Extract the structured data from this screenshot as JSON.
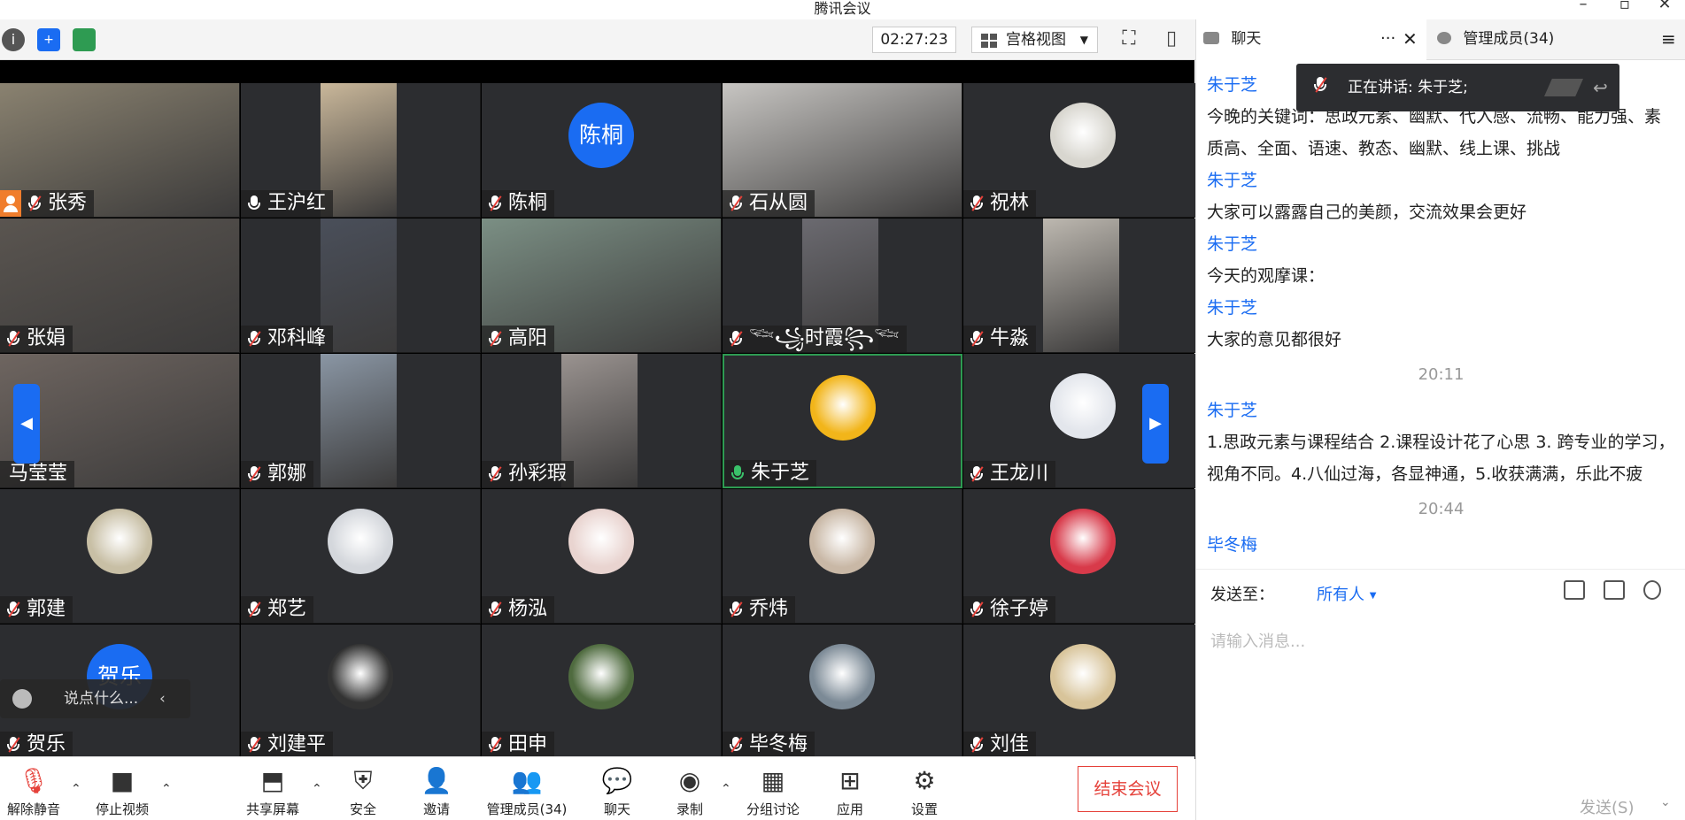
{
  "window": {
    "title": "腾讯会议"
  },
  "toolbar": {
    "timer": "02:27:23",
    "view_mode": "宫格视图"
  },
  "participants": [
    {
      "name": "张秀",
      "avatar": "video",
      "mic": "muted",
      "host": true,
      "color": "#8a8270"
    },
    {
      "name": "王沪红",
      "avatar": "video",
      "mic": "on-white",
      "color": "#c9b79a"
    },
    {
      "name": "陈桐",
      "avatar": "text",
      "avatar_text": "陈桐",
      "mic": "muted"
    },
    {
      "name": "石从圆",
      "avatar": "video",
      "mic": "muted",
      "color": "#c7c5c2"
    },
    {
      "name": "祝林",
      "avatar": "image",
      "mic": "muted",
      "color": "#d8d6cf"
    },
    {
      "name": "张娟",
      "avatar": "video",
      "mic": "muted",
      "color": "#5a5550"
    },
    {
      "name": "邓科峰",
      "avatar": "video",
      "mic": "muted",
      "color": "#4a4f5a"
    },
    {
      "name": "高阳",
      "avatar": "video",
      "mic": "muted",
      "color": "#7b8f84"
    },
    {
      "name": "𓆝꧁时霞꧂𓆝",
      "avatar": "video",
      "mic": "muted",
      "color": "#6b6a70"
    },
    {
      "name": "牛淼",
      "avatar": "video",
      "mic": "muted",
      "color": "#bdb8b0"
    },
    {
      "name": "马莹莹",
      "avatar": "video",
      "mic": "none",
      "color": "#6e6560"
    },
    {
      "name": "郭娜",
      "avatar": "video",
      "mic": "muted",
      "color": "#8a96a4"
    },
    {
      "name": "孙彩瑕",
      "avatar": "video",
      "mic": "muted",
      "color": "#9a9390"
    },
    {
      "name": "朱于芝",
      "avatar": "image",
      "mic": "speaking",
      "active": true,
      "color": "#f2b51a"
    },
    {
      "name": "王龙川",
      "avatar": "image",
      "mic": "muted",
      "color": "#e3e6ec"
    },
    {
      "name": "郭建",
      "avatar": "image",
      "mic": "muted",
      "color": "#c8bfa5"
    },
    {
      "name": "郑艺",
      "avatar": "image",
      "mic": "muted",
      "color": "#d4d7dc"
    },
    {
      "name": "杨泓",
      "avatar": "image",
      "mic": "muted",
      "color": "#e9d4d0"
    },
    {
      "name": "乔炜",
      "avatar": "image",
      "mic": "muted",
      "color": "#c9b8a6"
    },
    {
      "name": "徐子婷",
      "avatar": "image",
      "mic": "muted",
      "color": "#d83a4a"
    },
    {
      "name": "贺乐",
      "avatar": "text",
      "avatar_text": "贺乐",
      "mic": "muted"
    },
    {
      "name": "刘建平",
      "avatar": "image",
      "mic": "muted",
      "color": "#333333"
    },
    {
      "name": "田申",
      "avatar": "image",
      "mic": "muted",
      "color": "#4f6b3f"
    },
    {
      "name": "毕冬梅",
      "avatar": "image",
      "mic": "muted",
      "color": "#7c8a96"
    },
    {
      "name": "刘佳",
      "avatar": "image",
      "mic": "muted",
      "color": "#d8c49a"
    }
  ],
  "chat_overlay": {
    "placeholder": "说点什么..."
  },
  "bottombar": {
    "unmute": "解除静音",
    "stop_video": "停止视频",
    "share": "共享屏幕",
    "security": "安全",
    "invite": "邀请",
    "members": "管理成员(34)",
    "chat": "聊天",
    "record": "录制",
    "breakout": "分组讨论",
    "apps": "应用",
    "settings": "设置",
    "end": "结束会议"
  },
  "panel": {
    "tab_chat": "聊天",
    "tab_members": "管理成员(34)",
    "speaking": "正在讲话: 朱于芝;",
    "messages": [
      {
        "kind": "sender",
        "text": "朱于芝"
      },
      {
        "kind": "text",
        "text": "今晚的关键词：思政元素、幽默、代入感、流畅、能力强、素质高、全面、语速、教态、幽默、线上课、挑战"
      },
      {
        "kind": "sender",
        "text": "朱于芝"
      },
      {
        "kind": "text",
        "text": "大家可以露露自己的美颜，交流效果会更好"
      },
      {
        "kind": "sender",
        "text": "朱于芝"
      },
      {
        "kind": "text",
        "text": "今天的观摩课："
      },
      {
        "kind": "sender",
        "text": "朱于芝"
      },
      {
        "kind": "text",
        "text": "大家的意见都很好"
      },
      {
        "kind": "time",
        "text": "20:11"
      },
      {
        "kind": "sender",
        "text": "朱于芝"
      },
      {
        "kind": "text",
        "text": "1.思政元素与课程结合 2.课程设计花了心思  3. 跨专业的学习，视角不同。4.八仙过海，各显神通，5.收获满满，乐此不疲"
      },
      {
        "kind": "time",
        "text": "20:44"
      },
      {
        "kind": "sender",
        "text": "毕冬梅"
      }
    ],
    "send_to_label": "发送至：",
    "send_to_value": "所有人",
    "input_placeholder": "请输入消息...",
    "send_button": "发送(S)"
  }
}
